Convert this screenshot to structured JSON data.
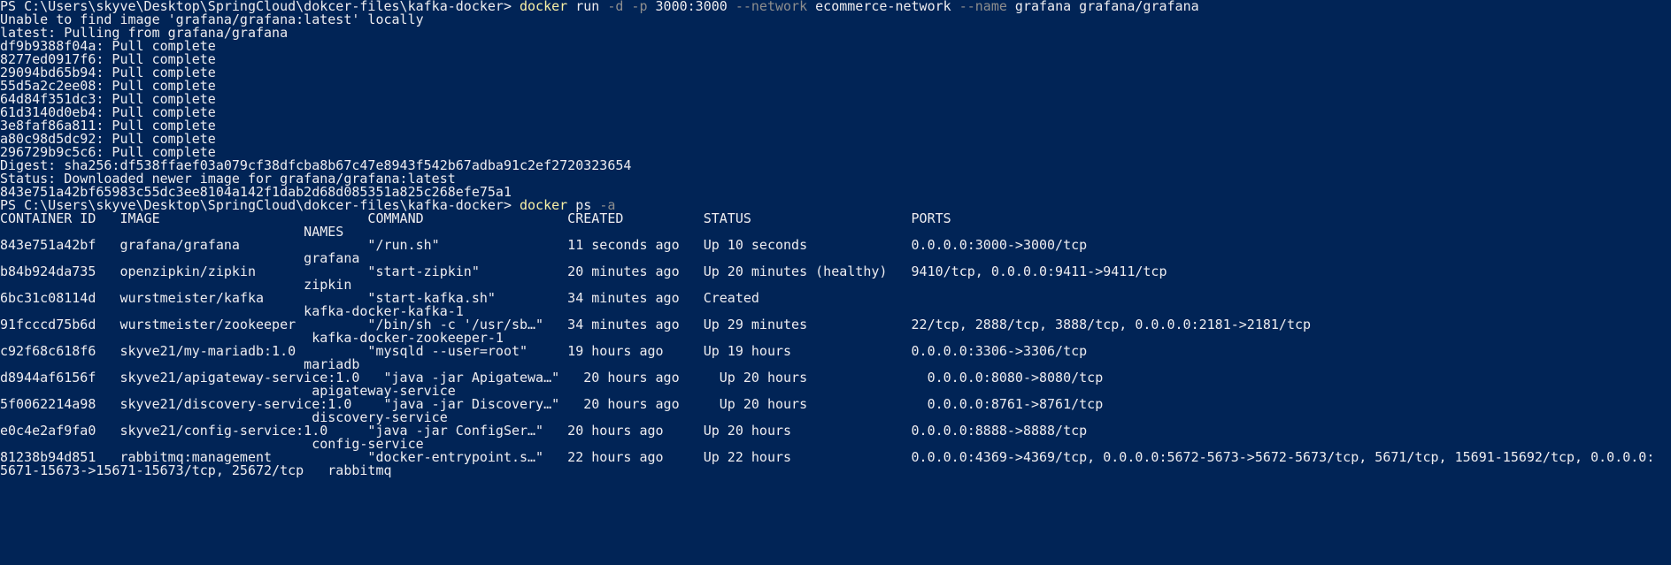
{
  "colors": {
    "background": "#012456",
    "foreground": "#eeedf0",
    "command": "#f9f1a5",
    "flag": "#8e8e8e"
  },
  "lines": [
    {
      "segs": [
        {
          "t": "PS C:\\Users\\skyve\\Desktop\\SpringCloud\\dokcer-files\\kafka-docker> ",
          "c": "path"
        },
        {
          "t": "docker",
          "c": "cmd"
        },
        {
          "t": " run ",
          "c": "text"
        },
        {
          "t": "-d -p",
          "c": "flag"
        },
        {
          "t": " 3000:3000 ",
          "c": "text"
        },
        {
          "t": "--network",
          "c": "flag"
        },
        {
          "t": " ecommerce-network ",
          "c": "text"
        },
        {
          "t": "--name",
          "c": "flag"
        },
        {
          "t": " grafana grafana/grafana",
          "c": "text"
        }
      ]
    },
    {
      "segs": [
        {
          "t": "Unable to find image 'grafana/grafana:latest' locally",
          "c": "text"
        }
      ]
    },
    {
      "segs": [
        {
          "t": "latest: Pulling from grafana/grafana",
          "c": "text"
        }
      ]
    },
    {
      "segs": [
        {
          "t": "df9b9388f04a: Pull complete",
          "c": "text"
        }
      ]
    },
    {
      "segs": [
        {
          "t": "8277ed0917f6: Pull complete",
          "c": "text"
        }
      ]
    },
    {
      "segs": [
        {
          "t": "29094bd65b94: Pull complete",
          "c": "text"
        }
      ]
    },
    {
      "segs": [
        {
          "t": "55d5a2c2ee08: Pull complete",
          "c": "text"
        }
      ]
    },
    {
      "segs": [
        {
          "t": "64d84f351dc3: Pull complete",
          "c": "text"
        }
      ]
    },
    {
      "segs": [
        {
          "t": "61d3140d0eb4: Pull complete",
          "c": "text"
        }
      ]
    },
    {
      "segs": [
        {
          "t": "3e8faf86a811: Pull complete",
          "c": "text"
        }
      ]
    },
    {
      "segs": [
        {
          "t": "a80c98d5dc92: Pull complete",
          "c": "text"
        }
      ]
    },
    {
      "segs": [
        {
          "t": "296729b9c5c6: Pull complete",
          "c": "text"
        }
      ]
    },
    {
      "segs": [
        {
          "t": "Digest: sha256:df538ffaef03a079cf38dfcba8b67c47e8943f542b67adba91c2ef2720323654",
          "c": "text"
        }
      ]
    },
    {
      "segs": [
        {
          "t": "Status: Downloaded newer image for grafana/grafana:latest",
          "c": "text"
        }
      ]
    },
    {
      "segs": [
        {
          "t": "843e751a42bf65983c55dc3ee8104a142f1dab2d68d085351a825c268efe75a1",
          "c": "text"
        }
      ]
    },
    {
      "segs": [
        {
          "t": "PS C:\\Users\\skyve\\Desktop\\SpringCloud\\dokcer-files\\kafka-docker> ",
          "c": "path"
        },
        {
          "t": "docker",
          "c": "cmd"
        },
        {
          "t": " ps ",
          "c": "text"
        },
        {
          "t": "-a",
          "c": "flag"
        }
      ]
    },
    {
      "segs": [
        {
          "t": "CONTAINER ID   IMAGE                          COMMAND                  CREATED          STATUS                    PORTS",
          "c": "text"
        }
      ]
    },
    {
      "segs": [
        {
          "t": "                                      NAMES",
          "c": "text"
        }
      ]
    },
    {
      "segs": [
        {
          "t": "843e751a42bf   grafana/grafana                \"/run.sh\"                11 seconds ago   Up 10 seconds             0.0.0.0:3000->3000/tcp",
          "c": "text"
        }
      ]
    },
    {
      "segs": [
        {
          "t": "                                      grafana",
          "c": "text"
        }
      ]
    },
    {
      "segs": [
        {
          "t": "b84b924da735   openzipkin/zipkin              \"start-zipkin\"           20 minutes ago   Up 20 minutes (healthy)   9410/tcp, 0.0.0.0:9411->9411/tcp",
          "c": "text"
        }
      ]
    },
    {
      "segs": [
        {
          "t": "                                      zipkin",
          "c": "text"
        }
      ]
    },
    {
      "segs": [
        {
          "t": "6bc31c08114d   wurstmeister/kafka             \"start-kafka.sh\"         34 minutes ago   Created",
          "c": "text"
        }
      ]
    },
    {
      "segs": [
        {
          "t": "                                      kafka-docker-kafka-1",
          "c": "text"
        }
      ]
    },
    {
      "segs": [
        {
          "t": "91fcccd75b6d   wurstmeister/zookeeper         \"/bin/sh -c '/usr/sb…\"   34 minutes ago   Up 29 minutes             22/tcp, 2888/tcp, 3888/tcp, 0.0.0.0:2181->2181/tcp",
          "c": "text"
        }
      ]
    },
    {
      "segs": [
        {
          "t": "                                       kafka-docker-zookeeper-1",
          "c": "text"
        }
      ]
    },
    {
      "segs": [
        {
          "t": "c92f68c618f6   skyve21/my-mariadb:1.0         \"mysqld --user=root\"     19 hours ago     Up 19 hours               0.0.0.0:3306->3306/tcp",
          "c": "text"
        }
      ]
    },
    {
      "segs": [
        {
          "t": "                                      mariadb",
          "c": "text"
        }
      ]
    },
    {
      "segs": [
        {
          "t": "d8944af6156f   skyve21/apigateway-service:1.0   \"java -jar Apigatewa…\"   20 hours ago     Up 20 hours               0.0.0.0:8080->8080/tcp",
          "c": "text"
        }
      ]
    },
    {
      "segs": [
        {
          "t": "                                       apigateway-service",
          "c": "text"
        }
      ]
    },
    {
      "segs": [
        {
          "t": "5f0062214a98   skyve21/discovery-service:1.0    \"java -jar Discovery…\"   20 hours ago     Up 20 hours               0.0.0.0:8761->8761/tcp",
          "c": "text"
        }
      ]
    },
    {
      "segs": [
        {
          "t": "                                       discovery-service",
          "c": "text"
        }
      ]
    },
    {
      "segs": [
        {
          "t": "e0c4e2af9fa0   skyve21/config-service:1.0     \"java -jar ConfigSer…\"   20 hours ago     Up 20 hours               0.0.0.0:8888->8888/tcp",
          "c": "text"
        }
      ]
    },
    {
      "segs": [
        {
          "t": "                                       config-service",
          "c": "text"
        }
      ]
    },
    {
      "segs": [
        {
          "t": "81238b94d851   rabbitmq:management            \"docker-entrypoint.s…\"   22 hours ago     Up 22 hours               0.0.0.0:4369->4369/tcp, 0.0.0.0:5672-5673->5672-5673/tcp, 5671/tcp, 15691-15692/tcp, 0.0.0.0:",
          "c": "text"
        }
      ]
    },
    {
      "segs": [
        {
          "t": "5671-15673->15671-15673/tcp, 25672/tcp   rabbitmq",
          "c": "text"
        }
      ]
    }
  ]
}
